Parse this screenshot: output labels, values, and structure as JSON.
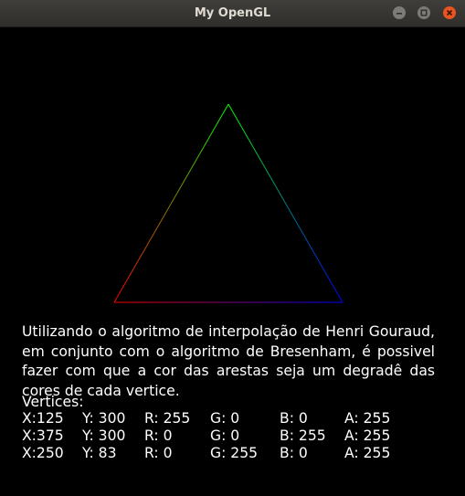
{
  "window": {
    "title": "My OpenGL",
    "buttons": {
      "minimize_icon": "minimize-icon",
      "maximize_icon": "maximize-icon",
      "close_icon": "close-icon"
    }
  },
  "colors": {
    "background": "#000000",
    "titlebar": "#35342f",
    "close_button": "#e95420",
    "text": "#ffffff"
  },
  "description": "Utilizando o algoritmo de interpolação de Henri Gouraud, em conjunto com o algoritmo de Bresenham, é possivel fazer com que a cor das arestas seja um degradê das cores de cada vertice.",
  "vertices_label": "Vertices:",
  "vertices": [
    {
      "x": "X:125",
      "y": "Y: 300",
      "r": "R: 255",
      "g": "G: 0",
      "b": "B: 0",
      "a": "A: 255",
      "color": "#ff0000"
    },
    {
      "x": "X:375",
      "y": "Y: 300",
      "r": "R: 0",
      "g": "G: 0",
      "b": "B: 255",
      "a": "A: 255",
      "color": "#0000ff"
    },
    {
      "x": "X:250",
      "y": "Y: 83",
      "r": "R: 0",
      "g": "G: 255",
      "b": "B: 0",
      "a": "A: 255",
      "color": "#00ff00"
    }
  ]
}
